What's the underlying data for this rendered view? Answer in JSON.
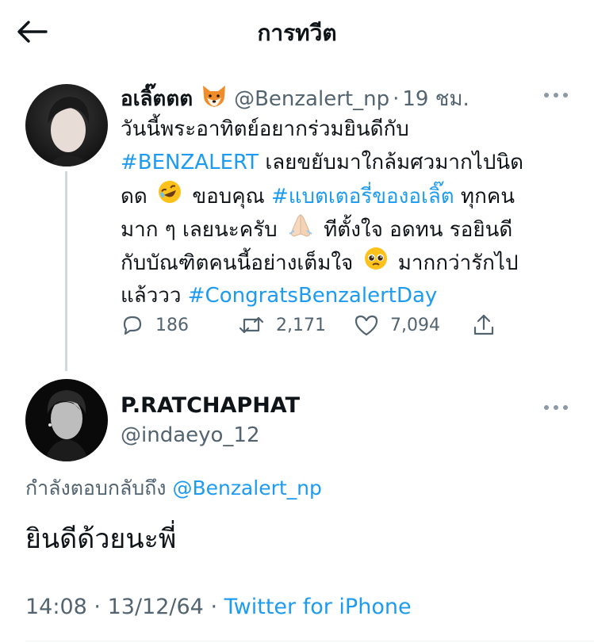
{
  "header": {
    "title": "การทวีต"
  },
  "original_tweet": {
    "display_name": "อเลิ๊ตตต",
    "name_emoji": "fox-face-emoji",
    "handle": "@Benzalert_np",
    "separator": "·",
    "time": "19 ชม.",
    "body": {
      "l1": "วันนี้พระอาทิตย์อยากร่วมยินดีกับ",
      "l2_hashtag": "#BENZALERT",
      "l2_text": " เลยขยับมาใกล้มศวมากไปนิด",
      "l3_a": "ดด",
      "l3_b": "ขอบคุณ",
      "l3_hashtag": "#แบตเตอรี่ของอเลิ๊ต",
      "l3_c": " ทุกคน",
      "l4_a": "มาก ๆ เลยนะครับ",
      "l4_b": "ทีตั้งใจ อดทน รอยินดี",
      "l5_a": "กับบัณฑิตคนนี้อย่างเต็มใจ",
      "l5_b": "มากกว่ารักไป",
      "l6_a": "แล้ววว ",
      "l6_hashtag": "#CongratsBenzalertDay"
    },
    "stats": {
      "replies": "186",
      "retweets": "2,171",
      "likes": "7,094"
    }
  },
  "reply_tweet": {
    "display_name": "P.RATCHAPHAT",
    "handle": "@indaeyo_12",
    "replying_prefix": "กำลังตอบกลับถึง ",
    "replying_handle": "@Benzalert_np",
    "text": "ยินดีด้วยนะพี่",
    "time": "14:08",
    "separator": "·",
    "date": "13/12/64",
    "separator2": "·",
    "source": "Twitter for iPhone"
  },
  "colors": {
    "accent": "#1d9bf0",
    "muted": "#536471",
    "text": "#0f1419",
    "thread_line": "#cfd9de"
  }
}
